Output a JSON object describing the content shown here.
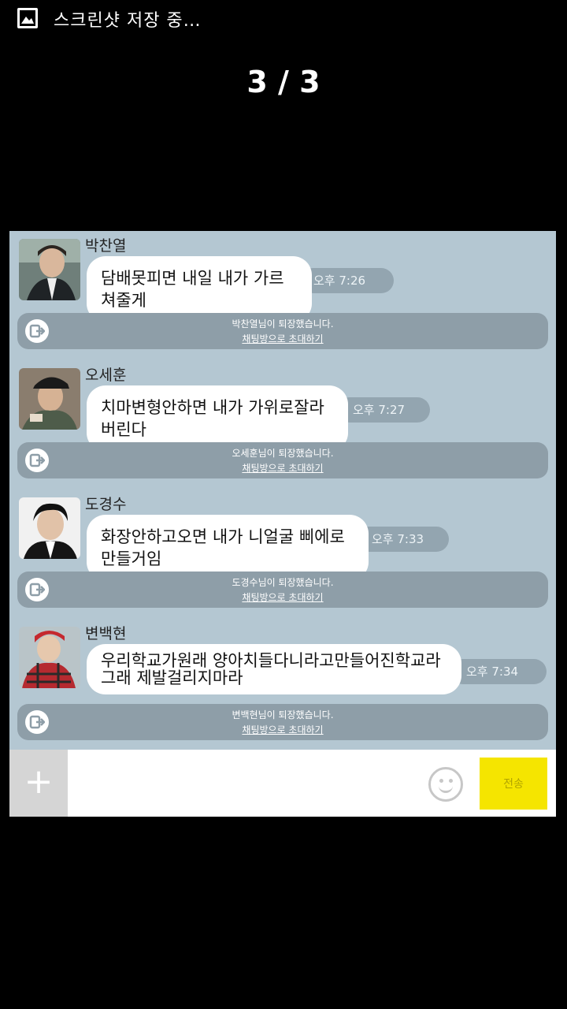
{
  "status_bar": {
    "text": "스크린샷 저장 중…",
    "icon": "image-icon"
  },
  "viewer": {
    "counter": "3 / 3"
  },
  "messages": [
    {
      "sender": "박찬열",
      "text": "담배못피면 내일 내가 가르쳐줄게",
      "time": "오후 7:26",
      "notice": {
        "line1": "박찬열님이 퇴장했습니다.",
        "line2": "채팅방으로 초대하기"
      }
    },
    {
      "sender": "오세훈",
      "text": "치마변형안하면 내가 가위로잘라버린다",
      "time": "오후 7:27",
      "notice": {
        "line1": "오세훈님이 퇴장했습니다.",
        "line2": "채팅방으로 초대하기"
      }
    },
    {
      "sender": "도경수",
      "text": "화장안하고오면 내가 니얼굴 삐에로만들거임",
      "time": "오후 7:33",
      "notice": {
        "line1": "도경수님이 퇴장했습니다.",
        "line2": "채팅방으로 초대하기"
      }
    },
    {
      "sender": "변백현",
      "text": "우리학교가원래 양아치들다니라고만들어진학교라그래 제발걸리지마라",
      "time": "오후 7:34",
      "notice": {
        "line1": "변백현님이 퇴장했습니다.",
        "line2": "채팅방으로 초대하기"
      }
    }
  ],
  "input_bar": {
    "plus_label": "+",
    "send_label": "전송",
    "input_value": "",
    "emoji_icon": "smiley-icon"
  },
  "colors": {
    "chat_bg": "#b4c7d2",
    "notice_bg": "#8e9ea8",
    "send_bg": "#f5e500"
  }
}
